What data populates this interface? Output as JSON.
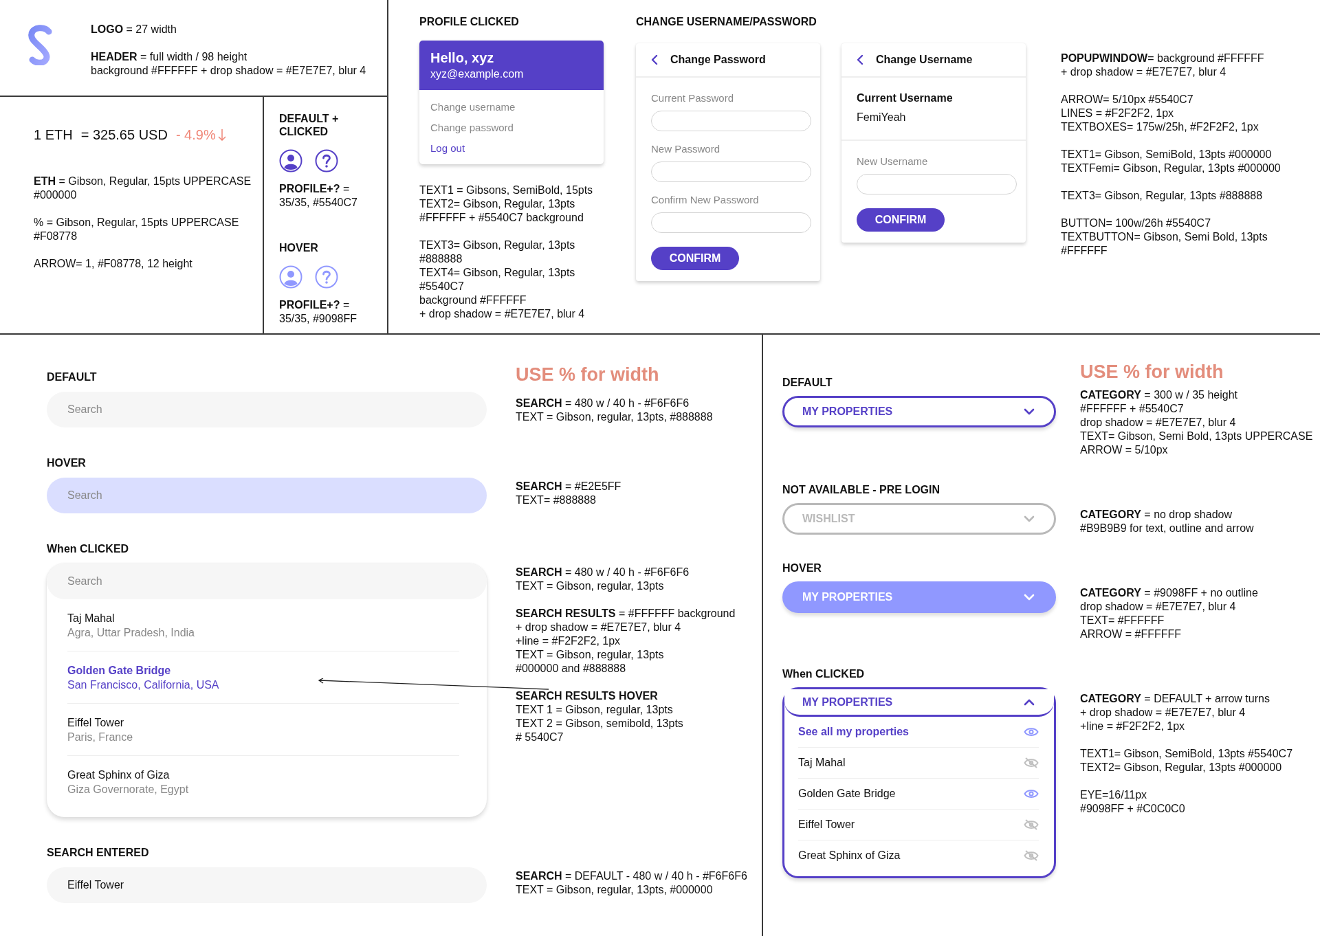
{
  "header_spec": {
    "notes": [
      [
        "**LOGO** = 27 width"
      ],
      [
        "**HEADER** = full width / 98 height",
        "background #FFFFFF + drop shadow = #E7E7E7, blur 4"
      ]
    ]
  },
  "eth_price": {
    "base": "1 ETH",
    "value": "= 325.65 USD",
    "change": "- 4.9%",
    "rising": false,
    "notes": [
      [
        "**ETH** = Gibson, Regular, 15pts UPPERCASE",
        "#000000"
      ],
      [
        "% = Gibson, Regular, 15pts UPPERCASE",
        "#F08778"
      ],
      [
        "ARROW= 1, #F08778, 12 height"
      ]
    ]
  },
  "icon_states": [
    {
      "title": "DEFAULT + CLICKED",
      "hovered": false,
      "notes": [
        [
          "**PROFILE+?** =",
          "35/35, #5540C7"
        ]
      ]
    },
    {
      "title": "HOVER",
      "hovered": true,
      "notes": [
        [
          "**PROFILE+?** =",
          "35/35, #9098FF"
        ]
      ]
    }
  ],
  "profile_clicked": {
    "title": "PROFILE CLICKED",
    "greeting": "Hello, xyz",
    "email": "xyz@example.com",
    "items": [
      {
        "label": "Change username",
        "kind": "option"
      },
      {
        "label": "Change password",
        "kind": "option"
      },
      {
        "label": "Log out",
        "kind": "link"
      }
    ],
    "notes": [
      [
        "TEXT1 = Gibsons, SemiBold, 15pts",
        "TEXT2= Gibson, Regular, 13pts",
        "#FFFFFF + #5540C7 background"
      ],
      [
        "TEXT3= Gibson, Regular, 13pts",
        "#888888",
        "TEXT4=  Gibson, Regular, 13pts",
        "#5540C7",
        "background #FFFFFF",
        "+ drop shadow = #E7E7E7, blur 4"
      ]
    ]
  },
  "change_credentials": {
    "title": "CHANGE USERNAME/PASSWORD",
    "cards": [
      {
        "kind": "password",
        "title": "Change Password",
        "fields": [
          "Current Password",
          "New Password",
          "Confirm New Password"
        ],
        "button": "CONFIRM"
      },
      {
        "kind": "username",
        "title": "Change Username",
        "current_label": "Current Username",
        "current_value": "FemiYeah",
        "fields": [
          "New Username"
        ],
        "button": "CONFIRM"
      }
    ],
    "notes": [
      [
        "**POPUPWINDOW**= background #FFFFFF",
        "+ drop shadow = #E7E7E7, blur 4"
      ],
      [
        "ARROW=  5/10px #5540C7",
        "LINES = #F2F2F2, 1px",
        "TEXTBOXES= 175w/25h,  #F2F2F2, 1px"
      ],
      [
        "TEXT1= Gibson, SemiBold, 13pts #000000",
        "TEXTFemi= Gibson, Regular, 13pts #000000"
      ],
      [
        "TEXT3= Gibson, Regular, 13pts #888888"
      ],
      [
        "BUTTON= 100w/26h #5540C7",
        "TEXTBUTTON= Gibson, Semi Bold, 13pts",
        "#FFFFFF"
      ]
    ]
  },
  "search_states": {
    "heading": "USE % for width",
    "states": [
      {
        "title": "DEFAULT",
        "hovered": false,
        "expanded": false,
        "placeholder": "Search",
        "notes": [
          [
            "**SEARCH** = 480 w / 40 h - #F6F6F6",
            "TEXT = Gibson, regular, 13pts, #888888"
          ]
        ]
      },
      {
        "title": "HOVER",
        "hovered": true,
        "expanded": false,
        "placeholder": "Search",
        "notes": [
          [
            "**SEARCH** = #E2E5FF",
            "TEXT= #888888"
          ]
        ]
      },
      {
        "title": "When CLICKED",
        "hovered": false,
        "expanded": true,
        "placeholder": "Search",
        "results": [
          {
            "name": "Taj Mahal",
            "place": "Agra, Uttar Pradesh, India",
            "hovered": false
          },
          {
            "name": "Golden Gate Bridge",
            "place": "San Francisco, California, USA",
            "hovered": true
          },
          {
            "name": "Eiffel Tower",
            "place": "Paris, France",
            "hovered": false
          },
          {
            "name": "Great Sphinx of Giza",
            "place": "Giza Governorate, Egypt",
            "hovered": false
          }
        ],
        "notes": [
          [
            "**SEARCH** = 480 w / 40 h - #F6F6F6",
            "TEXT = Gibson, regular, 13pts"
          ],
          [
            "**SEARCH RESULTS** = #FFFFFF background",
            "+ drop shadow = #E7E7E7, blur 4",
            "+line = #F2F2F2, 1px",
            "TEXT = Gibson, regular, 13pts",
            "#000000 and #888888"
          ],
          [
            "**SEARCH RESULTS HOVER**",
            "TEXT 1 = Gibson, regular, 13pts",
            "TEXT 2 = Gibson, semibold, 13pts",
            "# 5540C7"
          ]
        ]
      },
      {
        "title": "SEARCH ENTERED",
        "hovered": false,
        "expanded": false,
        "value": "Eiffel Tower",
        "notes": [
          [
            "**SEARCH** = DEFAULT - 480 w / 40 h - #F6F6F6",
            "TEXT = Gibson, regular, 13pts, #000000"
          ]
        ]
      }
    ]
  },
  "category_states": {
    "heading": "USE % for width",
    "states": [
      {
        "title": "DEFAULT",
        "disabled": false,
        "hovered": false,
        "expanded": false,
        "label": "MY PROPERTIES",
        "notes": [
          [
            "**CATEGORY** = 300 w  / 35 height",
            "#FFFFFF + #5540C7",
            "drop shadow = #E7E7E7, blur 4",
            "TEXT= Gibson, Semi Bold, 13pts UPPERCASE",
            "ARROW = 5/10px"
          ]
        ]
      },
      {
        "title": "NOT AVAILABLE - PRE LOGIN",
        "disabled": true,
        "hovered": false,
        "expanded": false,
        "label": "WISHLIST",
        "notes": [
          [
            "**CATEGORY** = no drop shadow",
            "#B9B9B9 for text, outline and arrow"
          ]
        ]
      },
      {
        "title": "HOVER",
        "disabled": false,
        "hovered": true,
        "expanded": false,
        "label": "MY PROPERTIES",
        "notes": [
          [
            "**CATEGORY** = #9098FF + no outline",
            "drop shadow = #E7E7E7, blur 4",
            "TEXT= #FFFFFF",
            "ARROW = #FFFFFF"
          ]
        ]
      },
      {
        "title": "When CLICKED",
        "disabled": false,
        "hovered": false,
        "expanded": true,
        "label": "MY PROPERTIES",
        "options": [
          {
            "label": "See all my properties",
            "kind": "all",
            "visible": true
          },
          {
            "label": "Taj Mahal",
            "kind": "item",
            "visible": false
          },
          {
            "label": "Golden Gate Bridge",
            "kind": "item",
            "visible": true
          },
          {
            "label": "Eiffel Tower",
            "kind": "item",
            "visible": false
          },
          {
            "label": "Great Sphinx of Giza",
            "kind": "item",
            "visible": false
          }
        ],
        "notes": [
          [
            "**CATEGORY** = DEFAULT + arrow turns",
            "+ drop shadow = #E7E7E7, blur 4",
            "+line = #F2F2F2, 1px"
          ],
          [
            "TEXT1= Gibson, SemiBold, 13pts #5540C7",
            "TEXT2= Gibson, Regular, 13pts #000000"
          ],
          [
            "EYE=16/11px",
            "#9098FF + #C0C0C0"
          ]
        ]
      }
    ]
  }
}
